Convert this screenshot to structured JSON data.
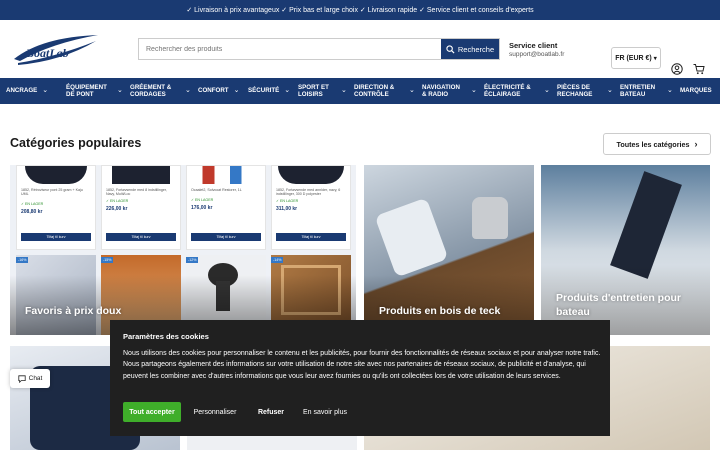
{
  "topbar": {
    "text": "✓ Livraison à prix avantageux ✓ Prix bas et large choix ✓ Livraison rapide ✓ Service client et conseils d'experts"
  },
  "header": {
    "logo_text": "BoatLab",
    "search_placeholder": "Rechercher des produits",
    "search_button": "Recherche",
    "service_title": "Service client",
    "service_email": "support@boatlab.fr",
    "lang": "FR (EUR €)"
  },
  "nav": [
    {
      "label": "ANCRAGE",
      "chev": true
    },
    {
      "label": "ÉQUIPEMENT DE PONT",
      "chev": true
    },
    {
      "label": "GRÉEMENT & CORDAGES",
      "chev": true
    },
    {
      "label": "CONFORT",
      "chev": true
    },
    {
      "label": "SÉCURITÉ",
      "chev": true
    },
    {
      "label": "SPORT ET LOISIRS",
      "chev": true
    },
    {
      "label": "DIRECTION & CONTRÔLE",
      "chev": true
    },
    {
      "label": "NAVIGATION & RADIO",
      "chev": true
    },
    {
      "label": "ÉLECTRICITÉ & ÉCLAIRAGE",
      "chev": true
    },
    {
      "label": "PIÈCES DE RECHANGE",
      "chev": true
    },
    {
      "label": "ENTRETIEN BATEAU",
      "chev": true
    },
    {
      "label": "MARQUES",
      "chev": false
    }
  ],
  "main": {
    "title": "Catégories populaires",
    "all_categories": "Toutes les catégories",
    "tiles": [
      {
        "label": "Favoris à prix doux"
      },
      {
        "label": "Produits en bois de teck"
      },
      {
        "label": "Produits d'entretien pour bateau"
      }
    ],
    "mini_products": [
      {
        "name": "1852, Rétroviseur pont 25 gram + Kaju UML",
        "badge": "✓ EN LAGER",
        "price": "208,80 kr",
        "button": "Tilføj til kurv"
      },
      {
        "name": "1852, Fortøvsende med 8 indstillinger, Navy, Multi/Loc",
        "badge": "✓ EN LAGER",
        "price": "226,00 kr",
        "button": "Tilføj til kurv"
      },
      {
        "name": "Ocaalet2, Solvcoat Restorer, 1L",
        "badge": "✓ EN LAGER",
        "price": "176,00 kr",
        "button": "Tilføj til kurv"
      },
      {
        "name": "1852, Fortøvsende med annlder, navy, 6 indstillinger, 300 D polyester",
        "badge": "✓ EN LAGER",
        "price": "311,00 kr",
        "button": "Tilføj til kurv"
      }
    ],
    "sale_badges": [
      "-16%",
      "-15%",
      "-12%",
      "-14%"
    ]
  },
  "cookie": {
    "title": "Paramètres des cookies",
    "text": "Nous utilisons des cookies pour personnaliser le contenu et les publicités, pour fournir des fonctionnalités de réseaux sociaux et pour analyser notre trafic. Nous partageons également des informations sur votre utilisation de notre site avec nos partenaires de réseaux sociaux, de publicité et d'analyse, qui peuvent les combiner avec d'autres informations que vous leur avez fournies ou qu'ils ont collectées lors de votre utilisation de leurs services.",
    "accept": "Tout accepter",
    "customize": "Personnaliser",
    "refuse": "Refuser",
    "more": "En savoir plus"
  },
  "chat": {
    "label": "Chat"
  },
  "colors": {
    "brand": "#1a3a72",
    "accept": "#3fae2a",
    "cookie_bg": "#202020"
  },
  "icons": [
    "search-icon",
    "user-icon",
    "cart-icon",
    "chevron-down-icon",
    "chevron-right-icon",
    "chat-icon"
  ]
}
